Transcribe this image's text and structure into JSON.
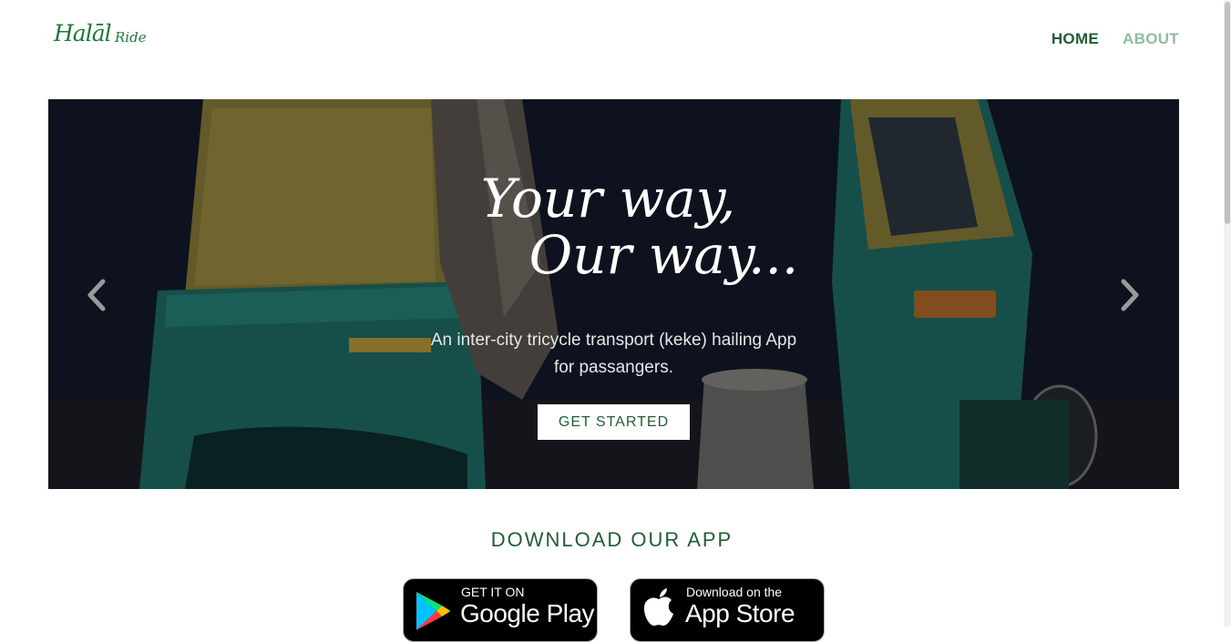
{
  "nav": {
    "logo_main": "Halāl",
    "logo_sub": "Ride",
    "links": [
      {
        "label": "HOME",
        "active": true
      },
      {
        "label": "ABOUT",
        "active": false
      }
    ]
  },
  "hero": {
    "title_line1": "Your way,",
    "title_line2": "Our way...",
    "subtitle_line1": "An inter-city tricycle transport (keke) hailing App",
    "subtitle_line2": "for passangers.",
    "cta_label": "GET STARTED",
    "prev_icon": "chevron-left-icon",
    "next_icon": "chevron-right-icon"
  },
  "download": {
    "heading": "DOWNLOAD OUR APP",
    "google": {
      "small": "GET IT ON",
      "big": "Google Play"
    },
    "apple": {
      "small": "Download on the",
      "big": "App Store"
    }
  },
  "colors": {
    "brand_green": "#1f5f35",
    "nav_inactive": "#8fbd9c",
    "logo_green": "#1e7a3c"
  }
}
